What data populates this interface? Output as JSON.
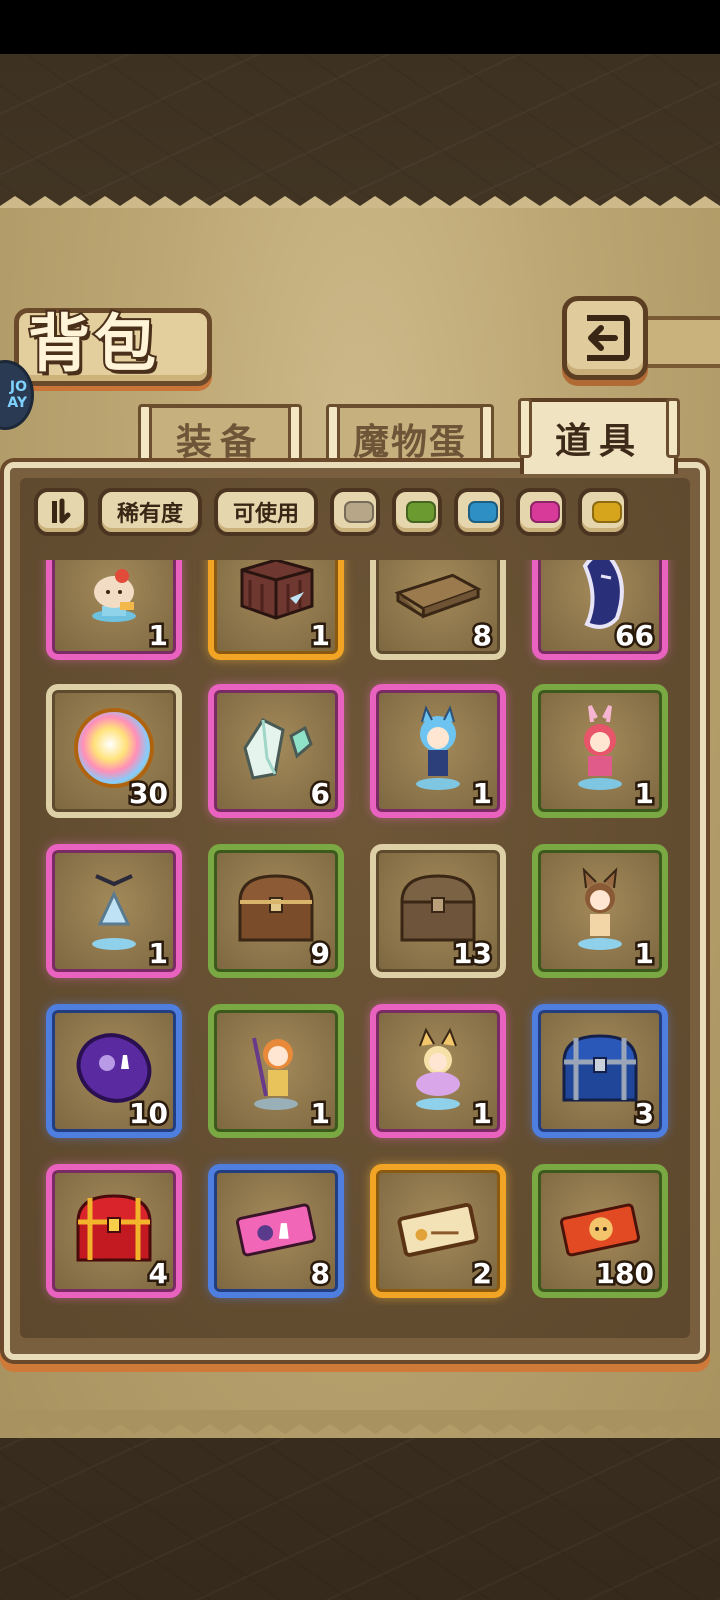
{
  "screen": {
    "title": "背包",
    "corner_logo": "JO\nAY"
  },
  "tabs": [
    {
      "label": "装备",
      "active": false
    },
    {
      "label": "魔物蛋",
      "active": false
    },
    {
      "label": "道具",
      "active": true
    }
  ],
  "filters": {
    "sort_icon": "sort-toggle-icon",
    "rarity_label": "稀有度",
    "usable_label": "可使用",
    "color_filters": [
      {
        "name": "white",
        "color": "#b7a788"
      },
      {
        "name": "green",
        "color": "#6b9a30"
      },
      {
        "name": "blue",
        "color": "#2d8fc4"
      },
      {
        "name": "pink",
        "color": "#d83a9a"
      },
      {
        "name": "yellow",
        "color": "#d7a51c"
      }
    ]
  },
  "rarity_colors": {
    "pink": "#ea62c0",
    "orange": "#f2a524",
    "white": "#ded0a6",
    "green": "#7aa843",
    "blue": "#4e7ee0"
  },
  "items": [
    {
      "name": "figure-apple-creature",
      "count": "1",
      "rarity": "pink"
    },
    {
      "name": "wooden-crate",
      "count": "1",
      "rarity": "orange"
    },
    {
      "name": "wooden-plank",
      "count": "8",
      "rarity": "white"
    },
    {
      "name": "moon-mask",
      "count": "66",
      "rarity": "pink"
    },
    {
      "name": "rainbow-orb",
      "count": "30",
      "rarity": "white"
    },
    {
      "name": "crystal-shards",
      "count": "6",
      "rarity": "pink"
    },
    {
      "name": "figure-blue-catgirl",
      "count": "1",
      "rarity": "pink"
    },
    {
      "name": "figure-bunny-girl",
      "count": "1",
      "rarity": "green"
    },
    {
      "name": "figure-maid",
      "count": "1",
      "rarity": "pink"
    },
    {
      "name": "treasure-chest-brown",
      "count": "9",
      "rarity": "green"
    },
    {
      "name": "treasure-chest-plain",
      "count": "13",
      "rarity": "white"
    },
    {
      "name": "figure-fox-girl",
      "count": "1",
      "rarity": "green"
    },
    {
      "name": "purple-coin",
      "count": "10",
      "rarity": "blue"
    },
    {
      "name": "figure-mage-girl",
      "count": "1",
      "rarity": "green"
    },
    {
      "name": "figure-fairy",
      "count": "1",
      "rarity": "pink"
    },
    {
      "name": "blue-chest",
      "count": "3",
      "rarity": "blue"
    },
    {
      "name": "red-chest",
      "count": "4",
      "rarity": "pink"
    },
    {
      "name": "pink-ticket",
      "count": "8",
      "rarity": "blue"
    },
    {
      "name": "gold-ticket",
      "count": "2",
      "rarity": "orange"
    },
    {
      "name": "red-ticket",
      "count": "180",
      "rarity": "green"
    }
  ]
}
